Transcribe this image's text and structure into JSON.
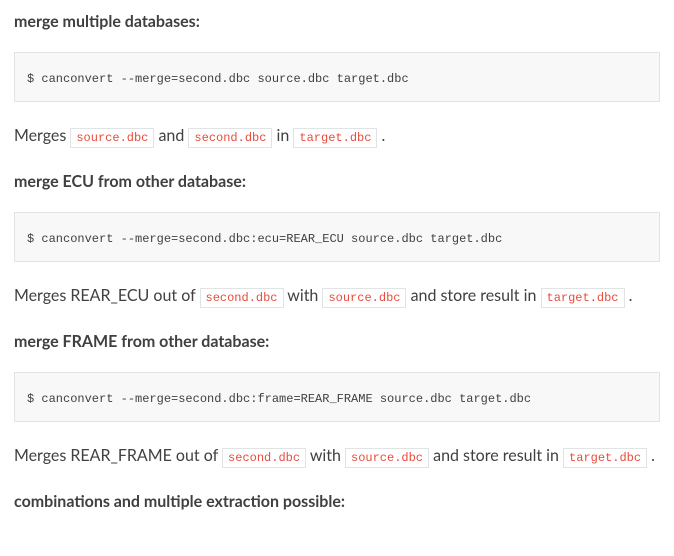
{
  "sections": [
    {
      "heading": "merge multiple databases:",
      "code": "$ canconvert --merge=second.dbc source.dbc target.dbc",
      "para": [
        {
          "t": "text",
          "v": "Merges "
        },
        {
          "t": "code",
          "v": "source.dbc"
        },
        {
          "t": "text",
          "v": " and "
        },
        {
          "t": "code",
          "v": "second.dbc"
        },
        {
          "t": "text",
          "v": " in "
        },
        {
          "t": "code",
          "v": "target.dbc"
        },
        {
          "t": "text",
          "v": " ."
        }
      ]
    },
    {
      "heading": "merge ECU from other database:",
      "code": "$ canconvert --merge=second.dbc:ecu=REAR_ECU source.dbc target.dbc",
      "para": [
        {
          "t": "text",
          "v": "Merges REAR_ECU out of "
        },
        {
          "t": "code",
          "v": "second.dbc"
        },
        {
          "t": "text",
          "v": " with "
        },
        {
          "t": "code",
          "v": "source.dbc"
        },
        {
          "t": "text",
          "v": " and store result in "
        },
        {
          "t": "code",
          "v": "target.dbc"
        },
        {
          "t": "text",
          "v": " ."
        }
      ]
    },
    {
      "heading": "merge FRAME from other database:",
      "code": "$ canconvert --merge=second.dbc:frame=REAR_FRAME source.dbc target.dbc",
      "para": [
        {
          "t": "text",
          "v": "Merges REAR_FRAME out of "
        },
        {
          "t": "code",
          "v": "second.dbc"
        },
        {
          "t": "text",
          "v": " with "
        },
        {
          "t": "code",
          "v": "source.dbc"
        },
        {
          "t": "text",
          "v": " and store result in "
        },
        {
          "t": "code",
          "v": "target.dbc"
        },
        {
          "t": "text",
          "v": " ."
        }
      ]
    },
    {
      "heading": "combinations and multiple extraction possible:"
    }
  ]
}
